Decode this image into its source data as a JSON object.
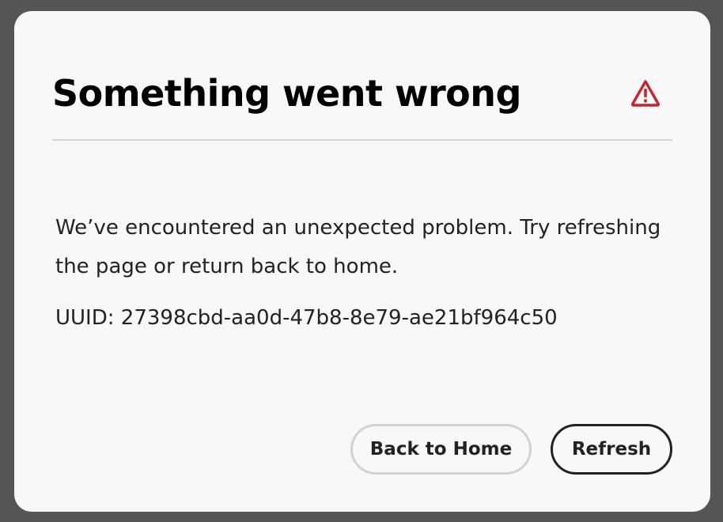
{
  "dialog": {
    "title": "Something went wrong",
    "alert_icon": "alert-triangle-icon",
    "message": "We’ve encountered an unexpected problem. Try refreshing the page or return back to home.",
    "uuid": "UUID: 27398cbd-aa0d-47b8-8e79-ae21bf964c50",
    "buttons": {
      "back_home_label": "Back to Home",
      "refresh_label": "Refresh"
    }
  },
  "colors": {
    "backdrop": "#555555",
    "dialog_bg": "#f8f8f8",
    "alert_red": "#c9252d",
    "text": "#222222"
  }
}
